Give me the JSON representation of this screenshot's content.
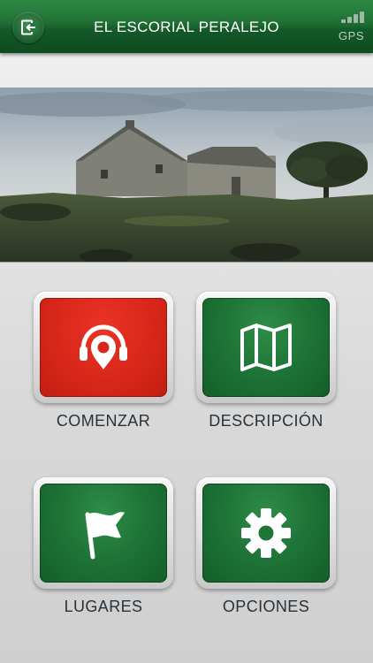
{
  "header": {
    "title": "EL ESCORIAL PERALEJO",
    "back_icon": "exit-icon",
    "gps_label": "GPS"
  },
  "banner": {
    "image": "photo-stone-farmhouse-landscape"
  },
  "menu": {
    "comenzar": {
      "label": "COMENZAR",
      "icon": "pin-headphones-icon",
      "color": "#d8271a"
    },
    "descripcion": {
      "label": "DESCRIPCIÓN",
      "icon": "map-icon",
      "color": "#1f7538"
    },
    "lugares": {
      "label": "LUGARES",
      "icon": "flag-icon",
      "color": "#1f7538"
    },
    "opciones": {
      "label": "OPCIONES",
      "icon": "gear-icon",
      "color": "#1f7538"
    }
  }
}
